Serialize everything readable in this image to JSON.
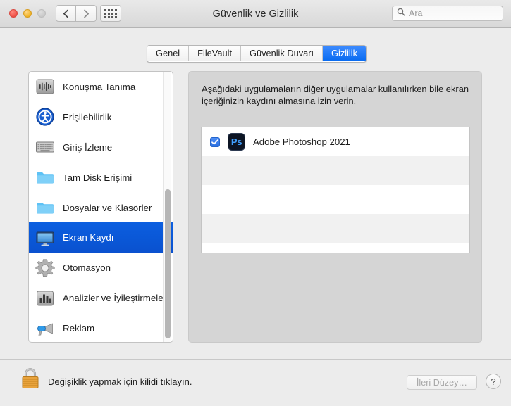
{
  "window": {
    "title": "Güvenlik ve Gizlilik",
    "traffic_lights": [
      "close",
      "minimize",
      "zoom-disabled"
    ],
    "back_label": "‹",
    "forward_label": "›",
    "grid_icon": "grid-dots-icon"
  },
  "search": {
    "placeholder": "Ara",
    "icon": "search-icon"
  },
  "tabs": [
    {
      "label": "Genel",
      "active": false
    },
    {
      "label": "FileVault",
      "active": false
    },
    {
      "label": "Güvenlik Duvarı",
      "active": false
    },
    {
      "label": "Gizlilik",
      "active": true
    }
  ],
  "sidebar": {
    "items": [
      {
        "label": "Konuşma Tanıma",
        "icon": "waveform-icon",
        "selected": false
      },
      {
        "label": "Erişilebilirlik",
        "icon": "accessibility-icon",
        "selected": false
      },
      {
        "label": "Giriş İzleme",
        "icon": "keyboard-icon",
        "selected": false
      },
      {
        "label": "Tam Disk Erişimi",
        "icon": "folder-icon",
        "selected": false
      },
      {
        "label": "Dosyalar ve Klasörler",
        "icon": "folder-icon",
        "selected": false
      },
      {
        "label": "Ekran Kaydı",
        "icon": "display-icon",
        "selected": true
      },
      {
        "label": "Otomasyon",
        "icon": "gear-icon",
        "selected": false
      },
      {
        "label": "Analizler ve İyileştirmeler",
        "icon": "bar-chart-icon",
        "selected": false
      },
      {
        "label": "Reklam",
        "icon": "megaphone-icon",
        "selected": false
      }
    ],
    "scrollbar": "vertical-scrollbar"
  },
  "panel": {
    "description": "Aşağıdaki uygulamaların diğer uygulamalar kullanılırken bile ekran içeriğinizin kaydını almasına izin verin.",
    "apps": [
      {
        "name": "Adobe Photoshop 2021",
        "checked": true,
        "icon": "photoshop-icon",
        "icon_text": "Ps"
      },
      {
        "name": "",
        "checked": false,
        "icon": "",
        "icon_text": ""
      },
      {
        "name": "",
        "checked": false,
        "icon": "",
        "icon_text": ""
      },
      {
        "name": "",
        "checked": false,
        "icon": "",
        "icon_text": ""
      }
    ]
  },
  "footer": {
    "lock_icon": "padlock-locked-icon",
    "lock_note": "Değişiklik yapmak için kilidi tıklayın.",
    "advanced_label": "İleri Düzey…",
    "advanced_enabled": false,
    "help_label": "?"
  },
  "colors": {
    "accent_blue": "#0a6cf1",
    "selection_blue": "#0b5fe0",
    "window_chrome": "#ececec",
    "panel_gray": "#d5d5d5",
    "lock_gold": "#e8a33d"
  }
}
